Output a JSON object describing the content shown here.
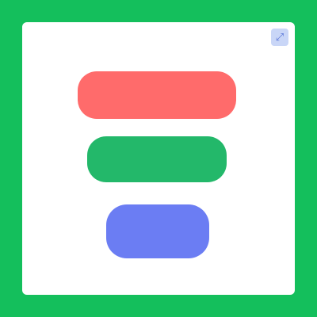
{
  "window": {
    "title": "",
    "corner_icon": "expand-icon"
  },
  "buttons": {
    "top_label": "",
    "middle_label": "",
    "bottom_label": ""
  },
  "colors": {
    "frame": "#14bf5c",
    "top_button": "#ff6b6b",
    "middle_button": "#23b86a",
    "bottom_button": "#6b7df3"
  }
}
